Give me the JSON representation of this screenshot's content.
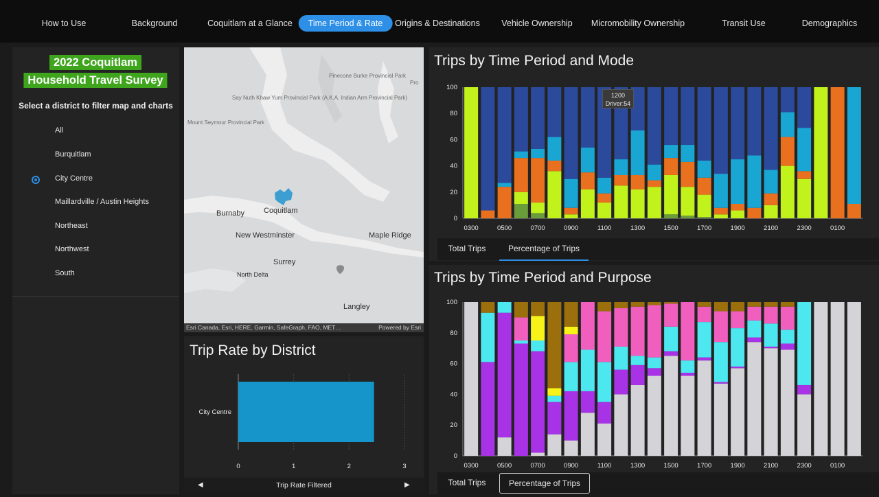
{
  "nav": {
    "items": [
      {
        "label": "How to Use"
      },
      {
        "label": "Background"
      },
      {
        "label": "Coquitlam at a Glance"
      },
      {
        "label": "Time Period & Rate"
      },
      {
        "label": "Origins & Destinations"
      },
      {
        "label": "Vehicle Ownership"
      },
      {
        "label": "Micromobility Ownership"
      },
      {
        "label": "Transit Use"
      },
      {
        "label": "Demographics"
      }
    ],
    "active": "Time Period & Rate"
  },
  "sidebar": {
    "title_line1": "2022 Coquitlam",
    "title_line2": "Household Travel Survey",
    "prompt": "Select a district to filter map and charts",
    "districts": [
      {
        "label": "All"
      },
      {
        "label": "Burquitlam"
      },
      {
        "label": "City Centre"
      },
      {
        "label": "Maillardville / Austin Heights"
      },
      {
        "label": "Northeast"
      },
      {
        "label": "Northwest"
      },
      {
        "label": "South"
      }
    ],
    "selected": "City Centre"
  },
  "map": {
    "labels": {
      "pinecone": "Pinecone Burke Provincial Park",
      "pro": "Pro",
      "say_nuth": "Say Nuth Khaw Yum Provincial Park (A.K.A. Indian Arm Provincial Park)",
      "mount_seymour": "Mount Seymour Provincial Park",
      "burnaby": "Burnaby",
      "coquitlam": "Coquitlam",
      "new_westminster": "New Westminster",
      "maple_ridge": "Maple Ridge",
      "surrey": "Surrey",
      "north_delta": "North Delta",
      "langley": "Langley"
    },
    "attribution": "Esri Canada, Esri, HERE, Garmin, SafeGraph, FAO, MET…",
    "powered": "Powered by Esri",
    "colors": {
      "highlight": "#3c9ed1",
      "land": "#d9dadb",
      "water": "#eeeeef"
    }
  },
  "rate_chart": {
    "title": "Trip Rate by District",
    "footer": "Trip Rate Filtered"
  },
  "mode_chart": {
    "title": "Trips by Time Period and Mode",
    "tooltip": {
      "line1": "1200",
      "line2": "Driver:54"
    },
    "tabs": [
      {
        "label": "Total Trips"
      },
      {
        "label": "Percentage of Trips"
      }
    ]
  },
  "purpose_chart": {
    "title": "Trips by Time Period and Purpose",
    "tabs": [
      {
        "label": "Total Trips"
      },
      {
        "label": "Percentage of Trips"
      }
    ]
  },
  "chart_data": [
    {
      "type": "bar",
      "orientation": "horizontal",
      "title": "Trip Rate by District",
      "xlabel": "Trip Rate Filtered",
      "categories": [
        "City Centre"
      ],
      "values": [
        2.45
      ],
      "xlim": [
        0,
        3
      ],
      "xticks": [
        0,
        1,
        2,
        3
      ],
      "colors": [
        "#1595c9"
      ]
    },
    {
      "type": "bar",
      "stacked": true,
      "title": "Trips by Time Period and Mode",
      "ylim": [
        0,
        100
      ],
      "yticks": [
        0,
        20,
        40,
        60,
        80,
        100
      ],
      "x_tick_labels": [
        "0300",
        "0500",
        "0700",
        "0900",
        "1100",
        "1300",
        "1500",
        "1700",
        "1900",
        "2100",
        "2300",
        "0100"
      ],
      "n_bars": 24,
      "series_colors": [
        "#6a9d3a",
        "#c2f21c",
        "#e8701e",
        "#1aa6d3",
        "#2c4a9c"
      ],
      "stacks": [
        [
          0,
          100,
          0,
          0,
          0
        ],
        [
          0,
          0,
          6,
          0,
          94
        ],
        [
          0,
          0,
          24,
          3,
          73
        ],
        [
          11,
          9,
          26,
          5,
          49
        ],
        [
          4,
          8,
          34,
          7,
          47
        ],
        [
          0,
          36,
          8,
          18,
          38
        ],
        [
          0,
          3,
          5,
          22,
          70
        ],
        [
          0,
          22,
          13,
          19,
          46
        ],
        [
          0,
          12,
          7,
          12,
          69
        ],
        [
          0,
          25,
          8,
          12,
          55
        ],
        [
          0,
          22,
          11,
          34,
          33
        ],
        [
          0,
          24,
          5,
          12,
          59
        ],
        [
          3,
          30,
          13,
          10,
          44
        ],
        [
          2,
          22,
          19,
          13,
          44
        ],
        [
          1,
          17,
          13,
          13,
          56
        ],
        [
          0,
          3,
          5,
          26,
          66
        ],
        [
          0,
          6,
          5,
          34,
          55
        ],
        [
          0,
          0,
          8,
          40,
          52
        ],
        [
          0,
          10,
          9,
          18,
          63
        ],
        [
          0,
          40,
          22,
          19,
          19
        ],
        [
          0,
          30,
          6,
          33,
          31
        ],
        [
          0,
          100,
          0,
          0,
          0
        ],
        [
          0,
          0,
          100,
          0,
          0
        ],
        [
          0,
          0,
          11,
          89,
          0
        ]
      ]
    },
    {
      "type": "bar",
      "stacked": true,
      "title": "Trips by Time Period and Purpose",
      "ylim": [
        0,
        100
      ],
      "yticks": [
        0,
        20,
        40,
        60,
        80,
        100
      ],
      "x_tick_labels": [
        "0300",
        "0500",
        "0700",
        "0900",
        "1100",
        "1300",
        "1500",
        "1700",
        "1900",
        "2100",
        "2300",
        "0100"
      ],
      "n_bars": 24,
      "series_colors": [
        "#d4d4d8",
        "#a832e6",
        "#4de7ef",
        "#f05fbe",
        "#f7f217",
        "#9c6f0d"
      ],
      "stacks": [
        [
          100,
          0,
          0,
          0,
          0,
          0
        ],
        [
          0,
          61,
          32,
          0,
          0,
          7
        ],
        [
          12,
          81,
          7,
          0,
          0,
          0
        ],
        [
          0,
          73,
          2,
          15,
          0,
          10
        ],
        [
          2,
          66,
          7,
          0,
          16,
          9
        ],
        [
          14,
          21,
          4,
          0,
          5,
          56
        ],
        [
          10,
          32,
          19,
          18,
          5,
          16
        ],
        [
          28,
          14,
          27,
          31,
          0,
          0
        ],
        [
          21,
          14,
          26,
          33,
          0,
          6
        ],
        [
          40,
          16,
          15,
          25,
          0,
          4
        ],
        [
          46,
          13,
          6,
          32,
          0,
          3
        ],
        [
          52,
          5,
          7,
          34,
          0,
          2
        ],
        [
          65,
          3,
          16,
          15,
          0,
          1
        ],
        [
          52,
          2,
          8,
          38,
          0,
          0
        ],
        [
          62,
          2,
          23,
          10,
          0,
          3
        ],
        [
          47,
          1,
          26,
          20,
          0,
          6
        ],
        [
          57,
          1,
          25,
          11,
          0,
          6
        ],
        [
          74,
          3,
          11,
          9,
          0,
          3
        ],
        [
          70,
          1,
          15,
          11,
          0,
          3
        ],
        [
          69,
          4,
          9,
          15,
          0,
          3
        ],
        [
          40,
          6,
          54,
          0,
          0,
          0
        ],
        [
          100,
          0,
          0,
          0,
          0,
          0
        ],
        [
          100,
          0,
          0,
          0,
          0,
          0
        ],
        [
          100,
          0,
          0,
          0,
          0,
          0
        ]
      ]
    }
  ]
}
